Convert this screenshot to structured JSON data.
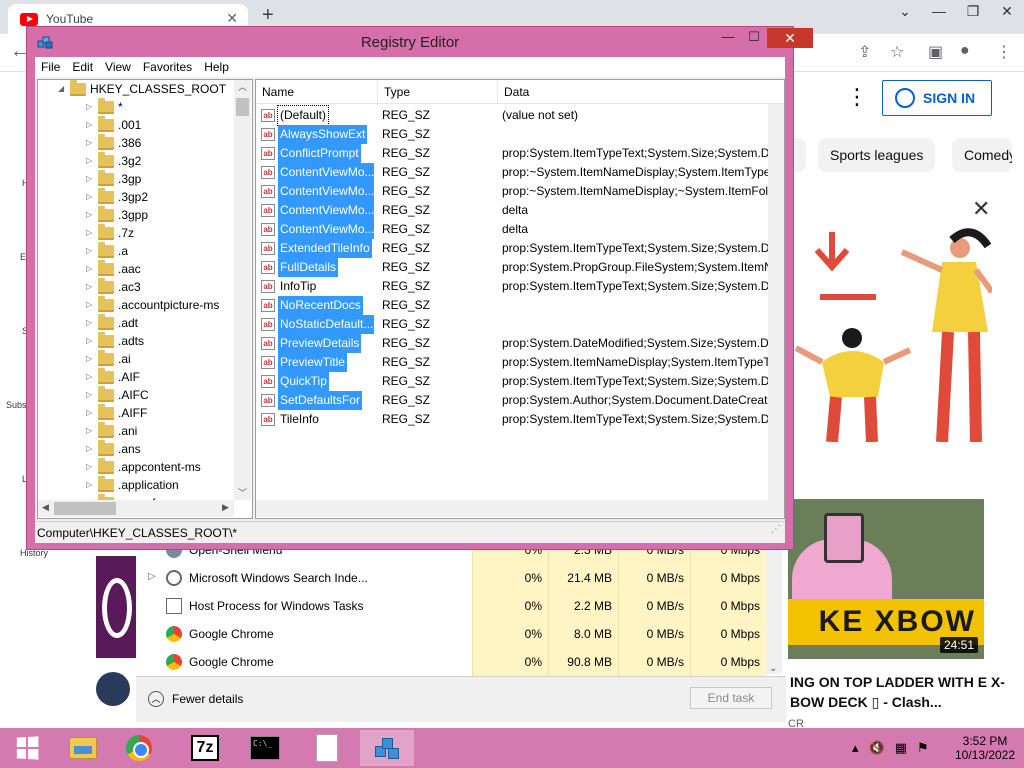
{
  "chrome": {
    "tab_title": "YouTube",
    "tab_close": "✕",
    "new_tab": "+",
    "minimize": "⌄",
    "restore": "❐",
    "close": "✕"
  },
  "youtube": {
    "sign_in": "SIGN IN",
    "chips": [
      "Sports leagues",
      "Comedy"
    ],
    "video_title": "ING ON TOP LADDER WITH E X-BOW DECK ▯ - Clash...",
    "video_channel": "CR",
    "thumb_overlay": "KE XBOW",
    "thumb_duration": "24:51",
    "left_nav": [
      "H",
      "E",
      "S",
      "Subs",
      "L",
      "History"
    ]
  },
  "task_manager": {
    "rows": [
      {
        "name": "Open-Shell Menu",
        "expand": "",
        "cpu": "0%",
        "mem": "2.3 MB",
        "disk": "0 MB/s",
        "net": "0 Mbps",
        "icon": "gear-icon"
      },
      {
        "name": "Microsoft Windows Search Inde...",
        "expand": "▷",
        "cpu": "0%",
        "mem": "21.4 MB",
        "disk": "0 MB/s",
        "net": "0 Mbps",
        "icon": "search-person-icon"
      },
      {
        "name": "Host Process for Windows Tasks",
        "expand": "",
        "cpu": "0%",
        "mem": "2.2 MB",
        "disk": "0 MB/s",
        "net": "0 Mbps",
        "icon": "window-icon"
      },
      {
        "name": "Google Chrome",
        "expand": "",
        "cpu": "0%",
        "mem": "8.0 MB",
        "disk": "0 MB/s",
        "net": "0 Mbps",
        "icon": "chrome-icon"
      },
      {
        "name": "Google Chrome",
        "expand": "",
        "cpu": "0%",
        "mem": "90.8 MB",
        "disk": "0 MB/s",
        "net": "0 Mbps",
        "icon": "chrome-icon"
      }
    ],
    "fewer_details": "Fewer details",
    "end_task": "End task"
  },
  "registry": {
    "title": "Registry Editor",
    "menu": [
      "File",
      "Edit",
      "View",
      "Favorites",
      "Help"
    ],
    "tree_root": "HKEY_CLASSES_ROOT",
    "tree_items": [
      "*",
      ".001",
      ".386",
      ".3g2",
      ".3gp",
      ".3gp2",
      ".3gpp",
      ".7z",
      ".a",
      ".aac",
      ".ac3",
      ".accountpicture-ms",
      ".adt",
      ".adts",
      ".ai",
      ".AIF",
      ".AIFC",
      ".AIFF",
      ".ani",
      ".ans",
      ".appcontent-ms",
      ".application",
      ".appref-ms"
    ],
    "columns": {
      "name": "Name",
      "type": "Type",
      "data": "Data"
    },
    "values": [
      {
        "name": "(Default)",
        "type": "REG_SZ",
        "data": "(value not set)",
        "selected": false,
        "focus": true
      },
      {
        "name": "AlwaysShowExt",
        "type": "REG_SZ",
        "data": "",
        "selected": true
      },
      {
        "name": "ConflictPrompt",
        "type": "REG_SZ",
        "data": "prop:System.ItemTypeText;System.Size;System.Dat...",
        "selected": true
      },
      {
        "name": "ContentViewMo...",
        "type": "REG_SZ",
        "data": "prop:~System.ItemNameDisplay;System.ItemType...",
        "selected": true
      },
      {
        "name": "ContentViewMo...",
        "type": "REG_SZ",
        "data": "prop:~System.ItemNameDisplay;~System.ItemFol...",
        "selected": true
      },
      {
        "name": "ContentViewMo...",
        "type": "REG_SZ",
        "data": "delta",
        "selected": true
      },
      {
        "name": "ContentViewMo...",
        "type": "REG_SZ",
        "data": "delta",
        "selected": true
      },
      {
        "name": "ExtendedTileInfo",
        "type": "REG_SZ",
        "data": "prop:System.ItemTypeText;System.Size;System.Dat...",
        "selected": true
      },
      {
        "name": "FullDetails",
        "type": "REG_SZ",
        "data": "prop:System.PropGroup.FileSystem;System.ItemN...",
        "selected": true
      },
      {
        "name": "InfoTip",
        "type": "REG_SZ",
        "data": "prop:System.ItemTypeText;System.Size;System.Dat...",
        "selected": false
      },
      {
        "name": "NoRecentDocs",
        "type": "REG_SZ",
        "data": "",
        "selected": true
      },
      {
        "name": "NoStaticDefault...",
        "type": "REG_SZ",
        "data": "",
        "selected": true
      },
      {
        "name": "PreviewDetails",
        "type": "REG_SZ",
        "data": "prop:System.DateModified;System.Size;System.Dat...",
        "selected": true
      },
      {
        "name": "PreviewTitle",
        "type": "REG_SZ",
        "data": "prop:System.ItemNameDisplay;System.ItemTypeT...",
        "selected": true
      },
      {
        "name": "QuickTip",
        "type": "REG_SZ",
        "data": "prop:System.ItemTypeText;System.Size;System.Dat...",
        "selected": true
      },
      {
        "name": "SetDefaultsFor",
        "type": "REG_SZ",
        "data": "prop:System.Author;System.Document.DateCreated",
        "selected": true
      },
      {
        "name": "TileInfo",
        "type": "REG_SZ",
        "data": "prop:System.ItemTypeText;System.Size;System.Dat...",
        "selected": false
      }
    ],
    "status": "Computer\\HKEY_CLASSES_ROOT\\*"
  },
  "taskbar": {
    "cmd_text": "C:\\_",
    "sevenzip_text": "7z",
    "time": "3:52 PM",
    "date": "10/13/2022"
  },
  "colors": {
    "window_frame": "#d56fa9",
    "selection": "#3399ff",
    "taskbar": "#d57ab1",
    "close_button": "#c7372b",
    "tm_highlight": "#fff4c4"
  }
}
